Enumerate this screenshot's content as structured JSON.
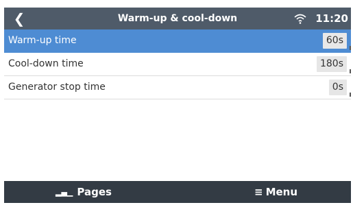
{
  "header": {
    "back_icon": "chevron-left-icon",
    "title": "Warm-up & cool-down",
    "wifi_icon": "wifi-icon",
    "clock": "11:20"
  },
  "settings": [
    {
      "label": "Warm-up time",
      "value": "60s",
      "selected": true
    },
    {
      "label": "Cool-down time",
      "value": "180s",
      "selected": false
    },
    {
      "label": "Generator stop time",
      "value": "0s",
      "selected": false
    }
  ],
  "footer": {
    "pages_icon": "bar-chart-icon",
    "pages_label": "Pages",
    "menu_icon": "hamburger-menu-icon",
    "menu_label": "Menu"
  },
  "colors": {
    "header_bg": "#4f5b69",
    "selected_bg": "#4e8cd3",
    "footer_bg": "#333b44"
  }
}
